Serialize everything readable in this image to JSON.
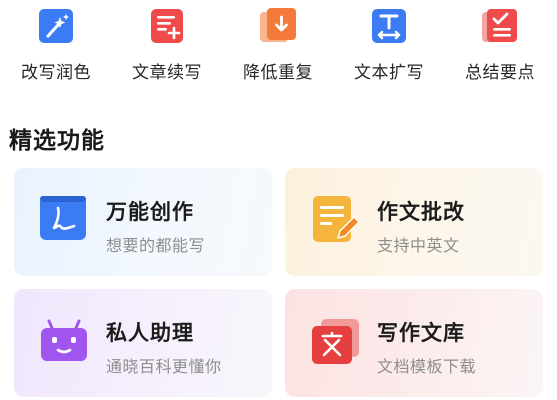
{
  "tools": [
    {
      "label": "改写润色",
      "icon": "magic-wand-icon",
      "color": "#3b7cf5"
    },
    {
      "label": "文章续写",
      "icon": "document-add-icon",
      "color": "#ef4b4b"
    },
    {
      "label": "降低重复",
      "icon": "download-doc-icon",
      "color": "#f47a3c"
    },
    {
      "label": "文本扩写",
      "icon": "text-expand-icon",
      "color": "#3b7cf5"
    },
    {
      "label": "总结要点",
      "icon": "checklist-icon",
      "color": "#ef4b4b"
    }
  ],
  "section": {
    "title": "精选功能"
  },
  "cards": [
    {
      "title": "万能创作",
      "subtitle": "想要的都能写",
      "icon": "handwriting-doc-icon",
      "color": "#3b7cf5"
    },
    {
      "title": "作文批改",
      "subtitle": "支持中英文",
      "icon": "essay-edit-icon",
      "color": "#f5b53c"
    },
    {
      "title": "私人助理",
      "subtitle": "通晓百科更懂你",
      "icon": "robot-icon",
      "color": "#a256f0"
    },
    {
      "title": "写作文库",
      "subtitle": "文档模板下载",
      "icon": "library-icon",
      "color": "#e63f3f"
    }
  ]
}
